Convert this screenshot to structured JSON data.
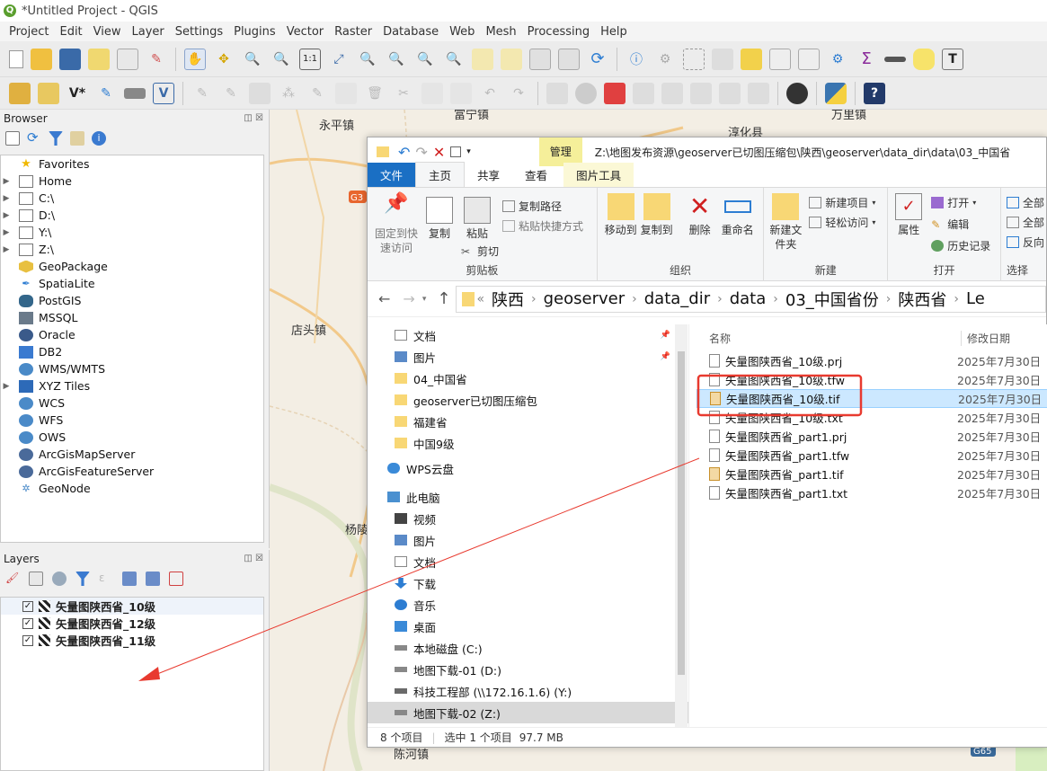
{
  "window": {
    "title": "*Untitled Project - QGIS"
  },
  "menu": [
    "Project",
    "Edit",
    "View",
    "Layer",
    "Settings",
    "Plugins",
    "Vector",
    "Raster",
    "Database",
    "Web",
    "Mesh",
    "Processing",
    "Help"
  ],
  "browser": {
    "title": "Browser",
    "items": [
      {
        "label": "Favorites",
        "icon": "star-icon",
        "expandable": false
      },
      {
        "label": "Home",
        "icon": "home-folder-icon",
        "expandable": true
      },
      {
        "label": "C:\\",
        "icon": "drive-icon",
        "expandable": true
      },
      {
        "label": "D:\\",
        "icon": "drive-icon",
        "expandable": true
      },
      {
        "label": "Y:\\",
        "icon": "drive-icon",
        "expandable": true
      },
      {
        "label": "Z:\\",
        "icon": "drive-icon",
        "expandable": true
      },
      {
        "label": "GeoPackage",
        "icon": "geopackage-icon",
        "expandable": false
      },
      {
        "label": "SpatiaLite",
        "icon": "spatialite-icon",
        "expandable": false
      },
      {
        "label": "PostGIS",
        "icon": "postgis-icon",
        "expandable": false
      },
      {
        "label": "MSSQL",
        "icon": "mssql-icon",
        "expandable": false
      },
      {
        "label": "Oracle",
        "icon": "oracle-icon",
        "expandable": false
      },
      {
        "label": "DB2",
        "icon": "db2-icon",
        "expandable": false
      },
      {
        "label": "WMS/WMTS",
        "icon": "globe-icon",
        "expandable": false
      },
      {
        "label": "XYZ Tiles",
        "icon": "xyz-tiles-icon",
        "expandable": true
      },
      {
        "label": "WCS",
        "icon": "globe-icon",
        "expandable": false
      },
      {
        "label": "WFS",
        "icon": "globe-icon",
        "expandable": false
      },
      {
        "label": "OWS",
        "icon": "globe-icon",
        "expandable": false
      },
      {
        "label": "ArcGisMapServer",
        "icon": "arcgis-icon",
        "expandable": false
      },
      {
        "label": "ArcGisFeatureServer",
        "icon": "arcgis-icon",
        "expandable": false
      },
      {
        "label": "GeoNode",
        "icon": "geonode-icon",
        "expandable": false
      }
    ]
  },
  "layers": {
    "title": "Layers",
    "items": [
      "矢量图陕西省_10级",
      "矢量图陕西省_12级",
      "矢量图陕西省_11级"
    ]
  },
  "map": {
    "labels": [
      "永平镇",
      "富宁镇",
      "淳化县",
      "万里镇",
      "店头镇",
      "杨陵",
      "陈河镇",
      "G3",
      "G65"
    ]
  },
  "explorer": {
    "manage_tab": "管理",
    "path": "Z:\\地图发布资源\\geoserver已切图压缩包\\陕西\\geoserver\\data_dir\\data\\03_中国省",
    "picture_tools": "图片工具",
    "tabs": [
      "文件",
      "主页",
      "共享",
      "查看"
    ],
    "ribbon": {
      "pin": "固定到快速访问",
      "copy": "复制",
      "paste": "粘贴",
      "copy_path": "复制路径",
      "paste_shortcut": "粘贴快捷方式",
      "cut": "剪切",
      "clipboard": "剪贴板",
      "move_to": "移动到",
      "copy_to": "复制到",
      "delete": "删除",
      "rename": "重命名",
      "organize": "组织",
      "new_folder": "新建文件夹",
      "new_item": "新建项目",
      "easy_access": "轻松访问",
      "new": "新建",
      "properties": "属性",
      "open": "打开",
      "edit": "编辑",
      "history": "历史记录",
      "open_group": "打开",
      "select_all": "全部",
      "select_none": "全部",
      "invert": "反向",
      "select_group": "选择"
    },
    "breadcrumbs": [
      "陕西",
      "geoserver",
      "data_dir",
      "data",
      "03_中国省份",
      "陕西省",
      "Le"
    ],
    "nav": [
      {
        "label": "文档",
        "icon": "document-icon",
        "pinned": true
      },
      {
        "label": "图片",
        "icon": "pictures-icon",
        "pinned": true
      },
      {
        "label": "04_中国省",
        "icon": "folder-icon",
        "pinned": false
      },
      {
        "label": "geoserver已切图压缩包",
        "icon": "folder-icon",
        "pinned": false
      },
      {
        "label": "福建省",
        "icon": "folder-icon",
        "pinned": false
      },
      {
        "label": "中国9级",
        "icon": "folder-icon",
        "pinned": false
      },
      {
        "label": "WPS云盘",
        "icon": "cloud-icon",
        "pinned": false
      },
      {
        "label": "此电脑",
        "icon": "computer-icon",
        "pinned": false
      },
      {
        "label": "视频",
        "icon": "video-icon",
        "pinned": false
      },
      {
        "label": "图片",
        "icon": "pictures-icon",
        "pinned": false
      },
      {
        "label": "文档",
        "icon": "document-icon",
        "pinned": false
      },
      {
        "label": "下载",
        "icon": "download-icon",
        "pinned": false
      },
      {
        "label": "音乐",
        "icon": "music-icon",
        "pinned": false
      },
      {
        "label": "桌面",
        "icon": "desktop-icon",
        "pinned": false
      },
      {
        "label": "本地磁盘 (C:)",
        "icon": "drive-icon",
        "pinned": false
      },
      {
        "label": "地图下载-01 (D:)",
        "icon": "drive-icon",
        "pinned": false
      },
      {
        "label": "科技工程部 (\\\\172.16.1.6) (Y:)",
        "icon": "network-drive-icon",
        "pinned": false
      },
      {
        "label": "地图下载-02 (Z:)",
        "icon": "drive-icon",
        "pinned": false
      }
    ],
    "columns": {
      "name": "名称",
      "date": "修改日期"
    },
    "files": [
      {
        "name": "矢量图陕西省_10级.prj",
        "date": "2025年7月30日",
        "type": "doc"
      },
      {
        "name": "矢量图陕西省_10级.tfw",
        "date": "2025年7月30日",
        "type": "doc"
      },
      {
        "name": "矢量图陕西省_10级.tif",
        "date": "2025年7月30日",
        "type": "tif"
      },
      {
        "name": "矢量图陕西省_10级.txt",
        "date": "2025年7月30日",
        "type": "doc"
      },
      {
        "name": "矢量图陕西省_part1.prj",
        "date": "2025年7月30日",
        "type": "doc"
      },
      {
        "name": "矢量图陕西省_part1.tfw",
        "date": "2025年7月30日",
        "type": "doc"
      },
      {
        "name": "矢量图陕西省_part1.tif",
        "date": "2025年7月30日",
        "type": "tif"
      },
      {
        "name": "矢量图陕西省_part1.txt",
        "date": "2025年7月30日",
        "type": "doc"
      }
    ],
    "status": {
      "count": "8 个项目",
      "selected": "选中 1 个项目",
      "size": "97.7 MB"
    }
  },
  "colors": {
    "annotation": "#e83a2f",
    "selection": "#cce8ff",
    "accent": "#0067c0"
  }
}
